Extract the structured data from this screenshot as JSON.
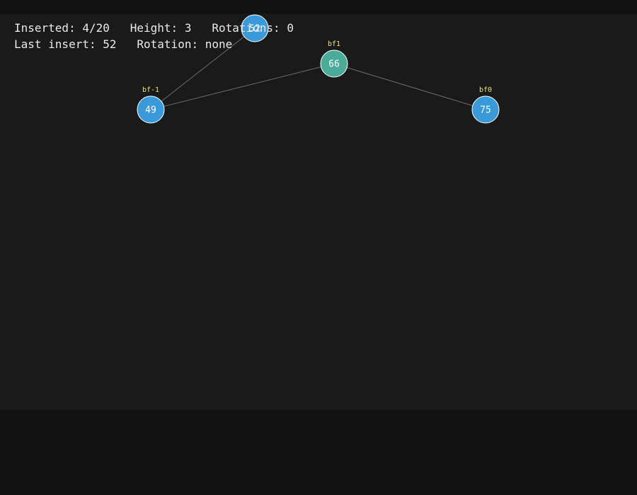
{
  "status": {
    "line1": "Inserted: 4/20   Height: 3   Rotations: 0",
    "line2": "Last insert: 52   Rotation: none"
  },
  "tree": {
    "nodes": [
      {
        "id": "n52",
        "value": "52",
        "bf": "",
        "color": "#3a9ad9"
      },
      {
        "id": "n66",
        "value": "66",
        "bf": "bf1",
        "color": "#4aab98"
      },
      {
        "id": "n49",
        "value": "49",
        "bf": "bf-1",
        "color": "#3a9ad9"
      },
      {
        "id": "n75",
        "value": "75",
        "bf": "bf0",
        "color": "#3a9ad9"
      }
    ],
    "edges": [
      {
        "from": "n52",
        "to": "n49"
      },
      {
        "from": "n66",
        "to": "n49"
      },
      {
        "from": "n66",
        "to": "n75"
      }
    ]
  },
  "colors": {
    "background": "#121212",
    "panel": "#1a1a1a",
    "edge": "#6b6b6b",
    "node_stroke": "#ffffff",
    "bf_label": "#f0e27a",
    "text": "#eaeaea"
  }
}
